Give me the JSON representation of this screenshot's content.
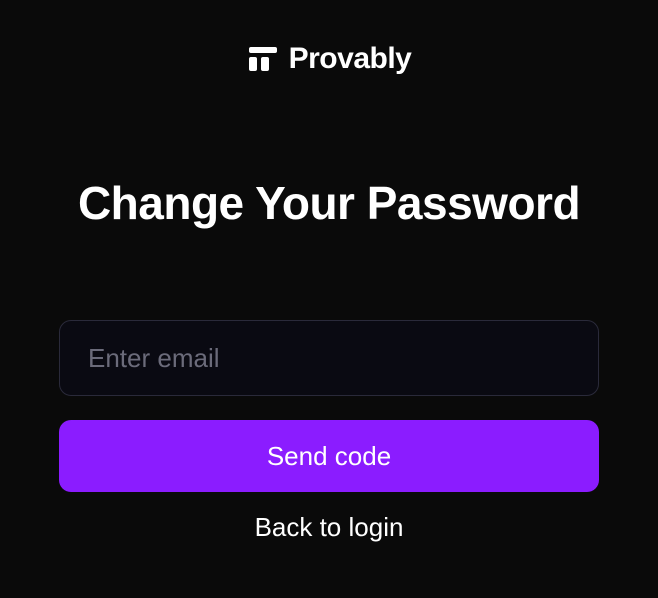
{
  "brand": {
    "name": "Provably"
  },
  "heading": "Change Your Password",
  "form": {
    "email_placeholder": "Enter email",
    "email_value": "",
    "send_button": "Send code",
    "back_link": "Back to login"
  }
}
